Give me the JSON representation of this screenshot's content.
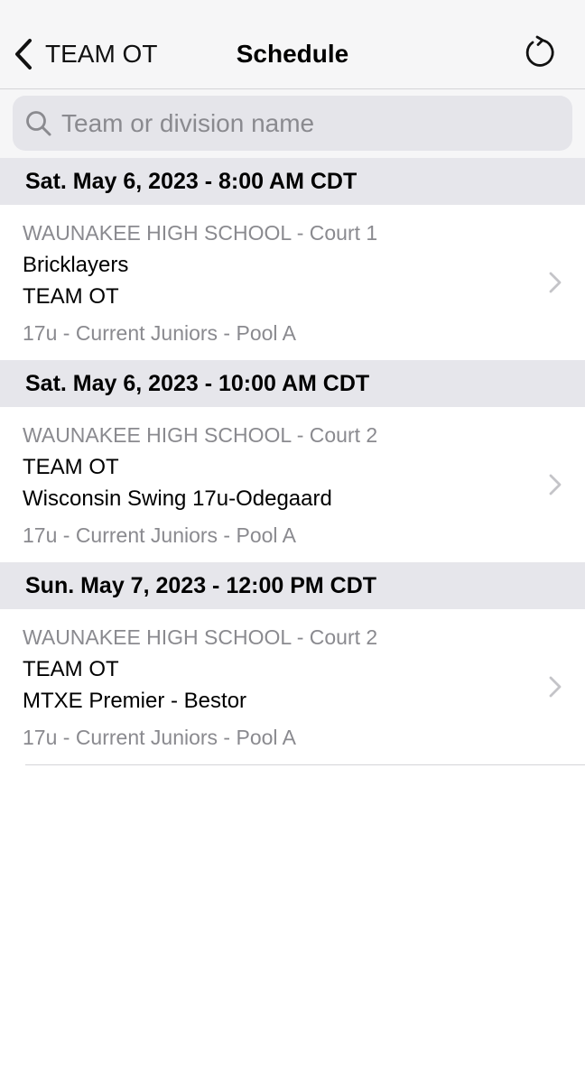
{
  "navbar": {
    "back_label": "TEAM OT",
    "title": "Schedule",
    "back_icon": "chevron-left-icon",
    "refresh_icon": "refresh-icon"
  },
  "search": {
    "placeholder": "Team or division name",
    "value": "",
    "icon": "search-icon"
  },
  "colors": {
    "header_bg": "#e6e6eb",
    "nav_bg": "#f6f6f7",
    "secondary_text": "#8a8a8f",
    "chevron": "#c4c4c8"
  },
  "sections": [
    {
      "header": "Sat. May 6, 2023 - 8:00 AM CDT",
      "match": {
        "venue": "WAUNAKEE HIGH SCHOOL - Court 1",
        "team1": "Bricklayers",
        "team2": "TEAM OT",
        "division": "17u - Current Juniors - Pool A"
      }
    },
    {
      "header": "Sat. May 6, 2023 - 10:00 AM CDT",
      "match": {
        "venue": "WAUNAKEE HIGH SCHOOL - Court 2",
        "team1": "TEAM OT",
        "team2": "Wisconsin Swing 17u-Odegaard",
        "division": "17u - Current Juniors - Pool A"
      }
    },
    {
      "header": "Sun. May 7, 2023 - 12:00 PM CDT",
      "match": {
        "venue": "WAUNAKEE HIGH SCHOOL - Court 2",
        "team1": "TEAM OT",
        "team2": "MTXE Premier - Bestor",
        "division": "17u - Current Juniors - Pool A"
      }
    }
  ]
}
